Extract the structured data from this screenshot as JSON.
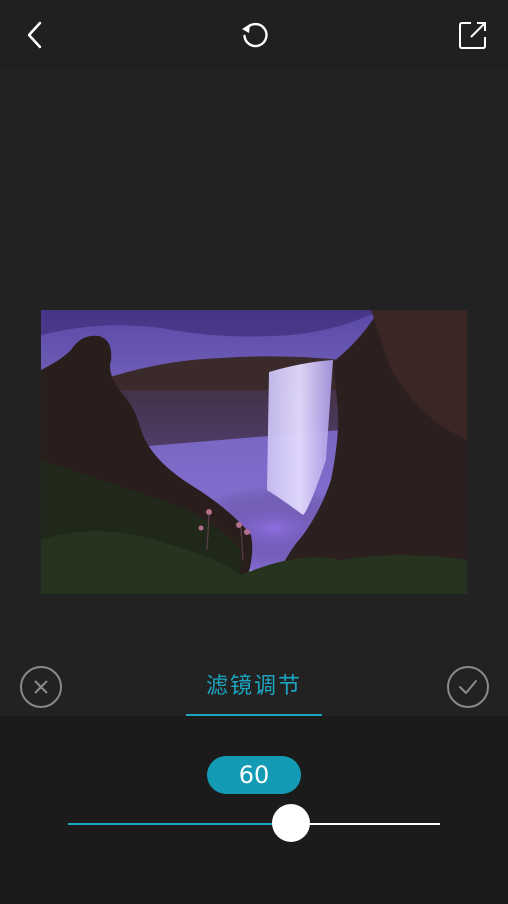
{
  "toolbar": {
    "back_icon": "chevron-left-icon",
    "undo_icon": "undo-icon",
    "share_icon": "share-icon"
  },
  "adjust": {
    "title": "滤镜调节",
    "cancel_icon": "close-circle-icon",
    "confirm_icon": "check-circle-icon"
  },
  "slider": {
    "value": "60",
    "fraction": 0.6,
    "accent_color": "#1ba7c3"
  }
}
